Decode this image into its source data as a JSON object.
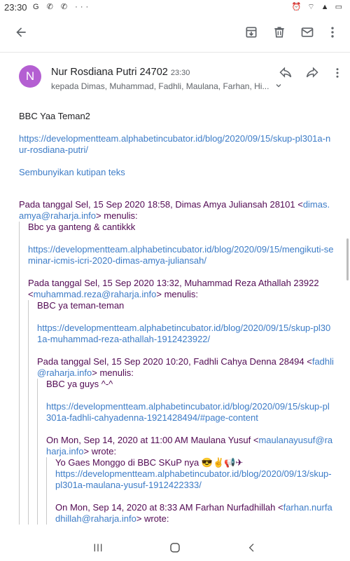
{
  "status": {
    "time": "23:30",
    "left_icons": "G ✆ ✆ ···",
    "right_icons": "⏰ ⌔ ▲ ▭"
  },
  "toolbar": {
    "back_icon": "arrow-left-icon",
    "archive_icon": "archive-icon",
    "delete_icon": "trash-icon",
    "mail_icon": "mail-icon",
    "more_icon": "more-vert-icon"
  },
  "message": {
    "avatar_letter": "N",
    "avatar_color": "#b45fd2",
    "sender": "Nur Rosdiana Putri 24702",
    "time": "23:30",
    "recipients": "kepada Dimas, Muhammad, Fadhli, Maulana, Farhan, Hi...",
    "greeting": "BBC Yaa Teman2",
    "link": "https://developmentteam.alphabetincubator.id/blog/2020/09/15/skup-pl301a-nur-rosdiana-putri/",
    "hide_quote": "Sembunyikan kutipan teks"
  },
  "quotes": [
    {
      "header_prefix": "Pada tanggal Sel, 15 Sep 2020 18:58, Dimas Amya Juliansah 28101 <",
      "email": "dimas.amya@raharja.info",
      "header_suffix": "> menulis:",
      "text": "Bbc ya ganteng & cantikkk",
      "link": "https://developmentteam.alphabetincubator.id/blog/2020/09/15/mengikuti-seminar-icmis-icri-2020-dimas-amya-juliansah/"
    },
    {
      "header_prefix": "Pada tanggal Sel, 15 Sep 2020 13:32, Muhammad Reza Athallah 23922 <",
      "email": "muhammad.reza@raharja.info",
      "header_suffix": "> menulis:",
      "text": "BBC ya teman-teman",
      "link": "https://developmentteam.alphabetincubator.id/blog/2020/09/15/skup-pl301a-muhammad-reza-athallah-1912423922/"
    },
    {
      "header_prefix": "Pada tanggal Sel, 15 Sep 2020 10:20, Fadhli Cahya Denna 28494 <",
      "email": "fadhli@raharja.info",
      "header_suffix": "> menulis:",
      "text": "BBC ya guys ^-^",
      "link": "https://developmentteam.alphabetincubator.id/blog/2020/09/15/skup-pl301a-fadhli-cahyadenna-1921428494/#page-content"
    },
    {
      "header_prefix": "On Mon, Sep 14, 2020 at 11:00 AM Maulana Yusuf <",
      "email": "maulanayusuf@raharja.info",
      "header_suffix": "> wrote:",
      "text": "Yo Gaes Monggo di BBC SKuP nya 😎✌📢✈",
      "link": "https://developmentteam.alphabetincubator.id/blog/2020/09/13/skup-pl301a-maulana-yusuf-1912422333/"
    },
    {
      "header_prefix": "On Mon, Sep 14, 2020 at 8:33 AM Farhan Nurfadhillah <",
      "email": "farhan.nurfadhillah@raharja.info",
      "header_suffix": "> wrote:"
    }
  ],
  "nav": {
    "recents_icon": "recents-icon",
    "home_icon": "home-icon",
    "back_icon": "nav-back-icon"
  }
}
